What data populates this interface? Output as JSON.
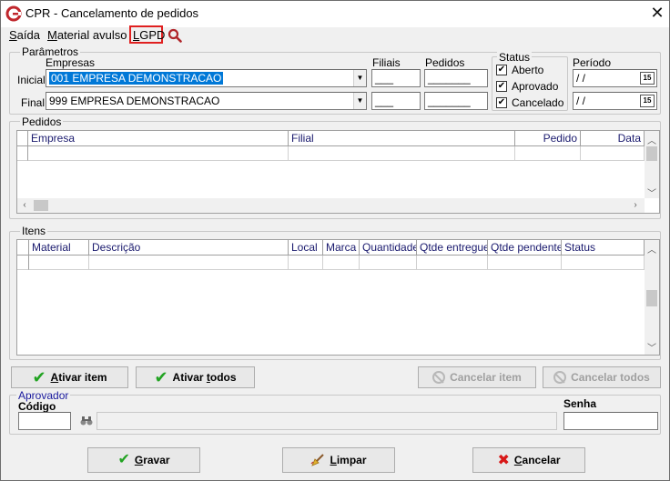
{
  "window": {
    "title": "CPR - Cancelamento de pedidos",
    "close_glyph": "✕"
  },
  "menu": {
    "saida": "Saída",
    "saida_u": "S",
    "saida_rest": "aída",
    "material": "Material avulso",
    "material_u": "M",
    "material_rest": "aterial avulso",
    "lgpd": "LGPD",
    "lgpd_u": "L",
    "lgpd_rest": "GPD"
  },
  "parametros": {
    "label": "Parâmetros",
    "empresas_label": "Empresas",
    "inicial_label": "Inicial",
    "final_label": "Final",
    "empresa_inicial": "001 EMPRESA DEMONSTRACAO",
    "empresa_final": "999 EMPRESA DEMONSTRACAO",
    "filiais_label": "Filiais",
    "pedidos_label": "Pedidos",
    "filial_inicial": "___",
    "filial_final": "___",
    "pedido_inicial": "_______",
    "pedido_final": "_______",
    "status_label": "Status",
    "status_options": [
      {
        "label": "Aberto",
        "checked": "✔"
      },
      {
        "label": "Aprovado",
        "checked": "✔"
      },
      {
        "label": "Cancelado",
        "checked": "✔"
      }
    ],
    "periodo_label": "Período",
    "periodo_inicial": " / /",
    "periodo_final": " / /",
    "cal_glyph": "15"
  },
  "pedidos": {
    "label": "Pedidos",
    "columns": [
      "Empresa",
      "Filial",
      "Pedido",
      "Data"
    ]
  },
  "itens": {
    "label": "Itens",
    "columns": [
      "Material",
      "Descrição",
      "Local",
      "Marca",
      "Quantidade",
      "Qtde entregue",
      "Qtde pendente",
      "Status"
    ]
  },
  "actions": {
    "ativar_item": "Ativar item",
    "ativar_item_u": "A",
    "ativar_item_rest": "tivar item",
    "ativar_todos_pre": "Ativar ",
    "ativar_todos_u": "t",
    "ativar_todos_rest": "odos",
    "cancelar_item": "Cancelar item",
    "cancelar_todos": "Cancelar todos"
  },
  "aprovador": {
    "label": "Aprovador",
    "codigo_label": "Código",
    "senha_label": "Senha",
    "codigo_value": "",
    "nome_value": "",
    "senha_value": ""
  },
  "footer": {
    "gravar_u": "G",
    "gravar_rest": "ravar",
    "limpar_u": "L",
    "limpar_rest": "impar",
    "cancelar_u": "C",
    "cancelar_rest": "ancelar"
  },
  "colors": {
    "selection": "#0078d7",
    "lgpd_highlight": "#e02020",
    "ok_green": "#22a322",
    "cancel_red": "#d81818"
  }
}
